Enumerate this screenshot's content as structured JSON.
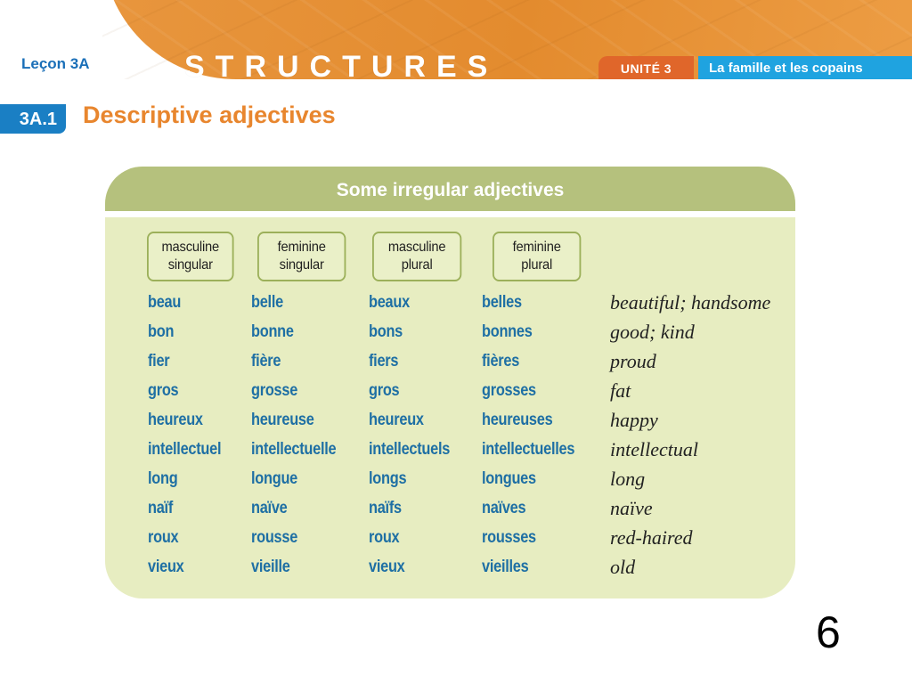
{
  "header": {
    "lesson": "Leçon 3A",
    "banner_title": "STRUCTURES",
    "unit_label": "UNITÉ 3",
    "unit_title": "La famille et les copains"
  },
  "section": {
    "number": "3A.1",
    "title": "Descriptive adjectives"
  },
  "table": {
    "title": "Some irregular adjectives",
    "columns": [
      {
        "line1": "masculine",
        "line2": "singular"
      },
      {
        "line1": "feminine",
        "line2": "singular"
      },
      {
        "line1": "masculine",
        "line2": "plural"
      },
      {
        "line1": "feminine",
        "line2": "plural"
      }
    ],
    "rows": [
      {
        "ms": "beau",
        "fs": "belle",
        "mp": "beaux",
        "fp": "belles",
        "meaning": "beautiful; handsome"
      },
      {
        "ms": "bon",
        "fs": "bonne",
        "mp": "bons",
        "fp": "bonnes",
        "meaning": "good; kind"
      },
      {
        "ms": "fier",
        "fs": "fière",
        "mp": "fiers",
        "fp": "fières",
        "meaning": "proud"
      },
      {
        "ms": "gros",
        "fs": "grosse",
        "mp": "gros",
        "fp": "grosses",
        "meaning": "fat"
      },
      {
        "ms": "heureux",
        "fs": "heureuse",
        "mp": "heureux",
        "fp": "heureuses",
        "meaning": "happy"
      },
      {
        "ms": "intellectuel",
        "fs": "intellectuelle",
        "mp": "intellectuels",
        "fp": "intellectuelles",
        "meaning": "intellectual"
      },
      {
        "ms": "long",
        "fs": "longue",
        "mp": "longs",
        "fp": "longues",
        "meaning": "long"
      },
      {
        "ms": "naïf",
        "fs": "naïve",
        "mp": "naïfs",
        "fp": "naïves",
        "meaning": "naïve"
      },
      {
        "ms": "roux",
        "fs": "rousse",
        "mp": "roux",
        "fp": "rousses",
        "meaning": "red-haired"
      },
      {
        "ms": "vieux",
        "fs": "vieille",
        "mp": "vieux",
        "fp": "vieilles",
        "meaning": "old"
      }
    ]
  },
  "page_number": "6",
  "colors": {
    "banner_orange": "#e38b2e",
    "unit_orange": "#e0662a",
    "unit_blue": "#1fa3e0",
    "section_blue": "#1a7fc4",
    "title_orange": "#e8862e",
    "card_bg": "#e7edc1",
    "card_header": "#b5c17d",
    "adjective_blue": "#1e6fa4"
  }
}
